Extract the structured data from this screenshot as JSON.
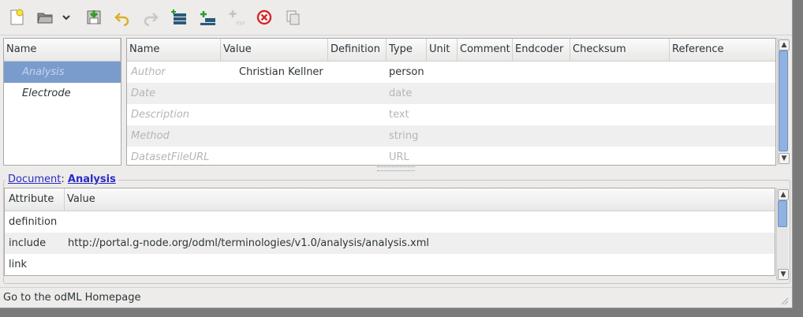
{
  "toolbar": {
    "icons": [
      "new-document-icon",
      "open-folder-icon",
      "dropdown-icon",
      "save-icon",
      "undo-icon",
      "redo-icon",
      "add-section-icon",
      "add-property-icon",
      "add-value-icon",
      "delete-icon",
      "clone-icon"
    ]
  },
  "sections": {
    "header": "Name",
    "items": [
      {
        "label": "Analysis",
        "selected": true
      },
      {
        "label": "Electrode",
        "selected": false
      }
    ]
  },
  "properties": {
    "columns": [
      "Name",
      "Value",
      "Definition",
      "Type",
      "Unit",
      "Comment",
      "Endcoder",
      "Checksum",
      "Reference"
    ],
    "rows": [
      {
        "name": "Author",
        "value": "Christian Kellner",
        "definition": "",
        "type": "person"
      },
      {
        "name": "Date",
        "value": "",
        "definition": "",
        "type": "date"
      },
      {
        "name": "Description",
        "value": "",
        "definition": "",
        "type": "text"
      },
      {
        "name": "Method",
        "value": "",
        "definition": "",
        "type": "string"
      },
      {
        "name": "DatasetFileURL",
        "value": "",
        "definition": "",
        "type": "URL"
      }
    ]
  },
  "breadcrumb": {
    "document": "Document",
    "separator": ":",
    "section": "Analysis"
  },
  "attributes": {
    "columns": [
      "Attribute",
      "Value"
    ],
    "rows": [
      {
        "attribute": "definition",
        "value": ""
      },
      {
        "attribute": "include",
        "value": "http://portal.g-node.org/odml/terminologies/v1.0/analysis/analysis.xml"
      },
      {
        "attribute": "link",
        "value": ""
      }
    ]
  },
  "status": {
    "text": "Go to the odML Homepage"
  },
  "colors": {
    "selection": "#7a9ccd",
    "link": "#2a2ac6",
    "delete": "#d42a2a"
  }
}
